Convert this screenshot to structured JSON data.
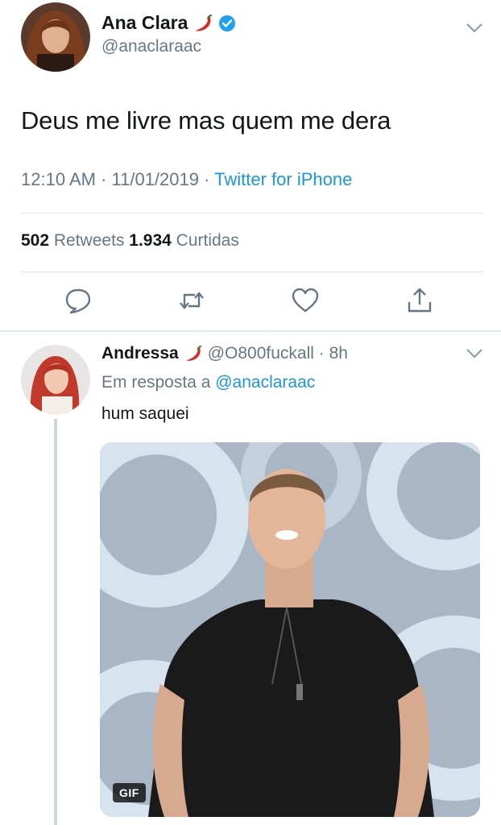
{
  "tweet": {
    "display_name": "Ana Clara",
    "handle": "@anaclaraac",
    "text": "Deus me livre mas quem me dera",
    "time": "12:10 AM · 11/01/2019 · ",
    "source": "Twitter for iPhone",
    "retweets_count": "502",
    "retweets_label": " Retweets ",
    "likes_count": "1.934",
    "likes_label": " Curtidas",
    "verified": true,
    "name_emoji": "chili-pepper-icon"
  },
  "actions": [
    {
      "name": "reply",
      "icon": "speech-bubble-icon"
    },
    {
      "name": "retweet",
      "icon": "retweet-icon"
    },
    {
      "name": "like",
      "icon": "heart-icon"
    },
    {
      "name": "share",
      "icon": "share-icon"
    }
  ],
  "reply": {
    "display_name": "Andressa",
    "handle_time": "@O800fuckall · 8h",
    "in_reply_prefix": "Em resposta a ",
    "in_reply_mention": "@anaclaraac",
    "text": "hum saquei",
    "media_badge": "GIF",
    "name_emoji": "chili-pepper-icon"
  },
  "colors": {
    "text_primary": "#14171a",
    "text_secondary": "#657786",
    "link": "#1b95e0",
    "verified": "#1da1f2",
    "divider": "#e1e8ed",
    "thread_line": "#ccd6dd"
  }
}
